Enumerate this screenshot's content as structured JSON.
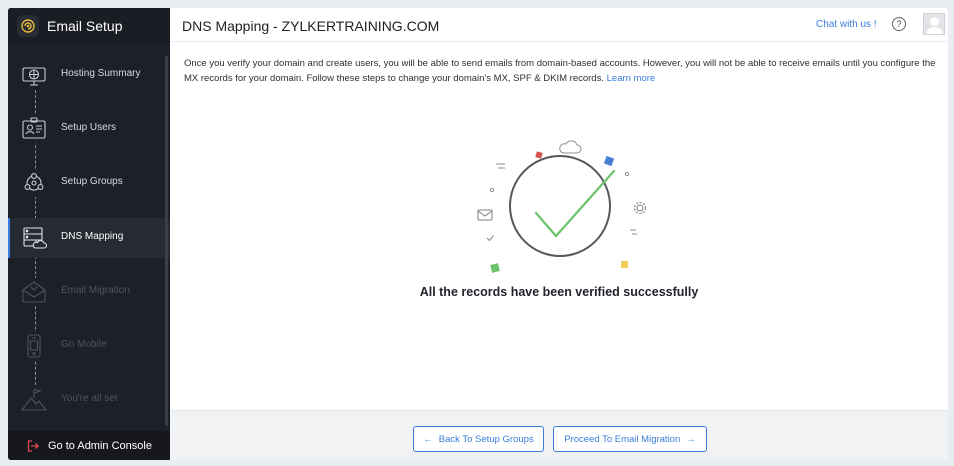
{
  "sidebar": {
    "title": "Email Setup",
    "steps": [
      {
        "label": "Hosting Summary",
        "icon": "globe-monitor-icon",
        "state": "done"
      },
      {
        "label": "Setup Users",
        "icon": "user-card-icon",
        "state": "done"
      },
      {
        "label": "Setup Groups",
        "icon": "group-icon",
        "state": "done"
      },
      {
        "label": "DNS Mapping",
        "icon": "server-cloud-icon",
        "state": "active"
      },
      {
        "label": "Email Migration",
        "icon": "envelope-open-icon",
        "state": "pending"
      },
      {
        "label": "Go Mobile",
        "icon": "mobile-icon",
        "state": "pending"
      },
      {
        "label": "You're all set",
        "icon": "mountain-flag-icon",
        "state": "pending"
      }
    ],
    "admin_label": "Go to Admin Console"
  },
  "header": {
    "title": "DNS Mapping - ZYLKERTRAINING.COM",
    "chat_label": "Chat with us !",
    "help_symbol": "?"
  },
  "main": {
    "description": "Once you verify your domain and create users, you will be able to send emails from domain-based accounts. However, you will not be able to receive emails until you configure the MX records for your domain. Follow these steps to change your domain's MX, SPF & DKIM records.",
    "learn_more": "Learn more",
    "success_message": "All the records have been verified successfully"
  },
  "footer": {
    "back_label": "Back To Setup Groups",
    "next_label": "Proceed To Email Migration"
  },
  "colors": {
    "accent": "#3b7ddd",
    "sidebar_bg": "#1c2029",
    "check_green": "#6cc26a"
  }
}
